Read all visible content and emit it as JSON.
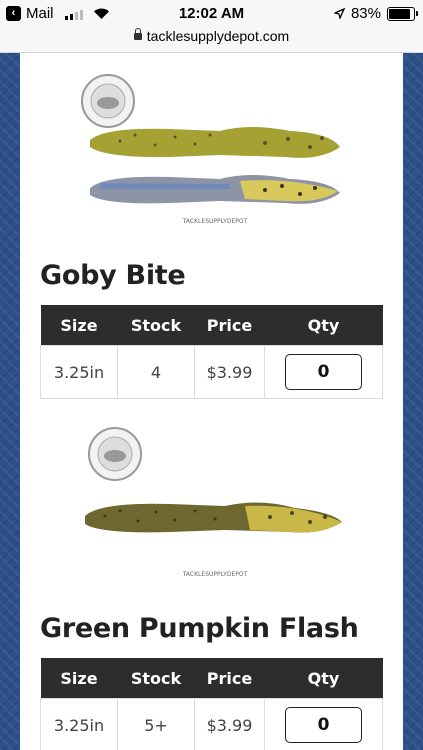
{
  "status_bar": {
    "back_app": "Mail",
    "time": "12:02 AM",
    "battery_percent": "83%",
    "signal_bars": 4,
    "signal_bars_filled": 2
  },
  "browser": {
    "url": "tacklesupplydepot.com"
  },
  "table_headers": {
    "size": "Size",
    "stock": "Stock",
    "price": "Price",
    "qty": "Qty"
  },
  "products": [
    {
      "title": "Goby Bite",
      "watermark": "TACKLESUPPLYDEPOT",
      "logo_text": "TACKLE SUPPLY DEPOT",
      "row": {
        "size": "3.25in",
        "stock": "4",
        "price": "$3.99",
        "qty": "0"
      },
      "colors": [
        "#a7a033",
        "#8b93a8"
      ]
    },
    {
      "title": "Green Pumpkin Flash",
      "watermark": "TACKLESUPPLYDEPOT",
      "logo_text": "TACKLE SUPPLY DEPOT",
      "row": {
        "size": "3.25in",
        "stock": "5+",
        "price": "$3.99",
        "qty": "0"
      },
      "colors": [
        "#6b6530"
      ]
    }
  ],
  "accent_colors": {
    "page_background": "#2c5189",
    "table_header": "#2d2d2d"
  }
}
